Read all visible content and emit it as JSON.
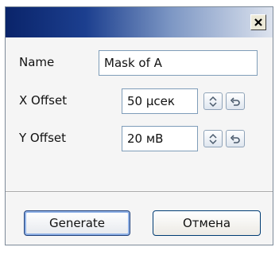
{
  "window": {
    "title": "",
    "close_icon": "close-icon"
  },
  "form": {
    "name_label": "Name",
    "name_value": "Mask of A",
    "x_offset_label": "X Offset",
    "x_offset_value": "50 µсек",
    "y_offset_label": "Y Offset",
    "y_offset_value": "20 мВ",
    "spin_icon": "spin-up-down-icon",
    "reset_icon": "undo-icon"
  },
  "buttons": {
    "generate_label": "Generate",
    "cancel_label": "Отмена"
  },
  "colors": {
    "title_gradient_start": "#0a246a",
    "title_gradient_end": "#dde3ee",
    "field_border": "#7f9db9",
    "primary_button_border": "#1f3f7a"
  }
}
